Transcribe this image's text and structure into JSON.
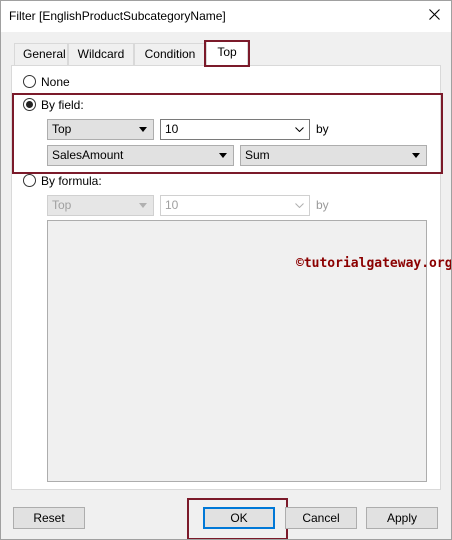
{
  "window": {
    "title": "Filter [EnglishProductSubcategoryName]",
    "close_glyph": "close-icon"
  },
  "tabs": [
    {
      "label": "General",
      "active": false
    },
    {
      "label": "Wildcard",
      "active": false
    },
    {
      "label": "Condition",
      "active": false
    },
    {
      "label": "Top",
      "active": true
    }
  ],
  "options": {
    "none_label": "None",
    "by_field": {
      "label": "By field:",
      "selected": true,
      "direction_value": "Top",
      "count_value": "10",
      "by_label": "by",
      "field_value": "SalesAmount",
      "aggregation_value": "Sum"
    },
    "by_formula": {
      "label": "By formula:",
      "selected": false,
      "direction_value": "Top",
      "count_value": "10",
      "by_label": "by"
    }
  },
  "watermark": "©tutorialgateway.org",
  "buttons": {
    "reset": "Reset",
    "ok": "OK",
    "cancel": "Cancel",
    "apply": "Apply"
  },
  "colors": {
    "highlight": "#7b1a2a",
    "accent": "#0078d7",
    "watermark": "#8b0000"
  }
}
